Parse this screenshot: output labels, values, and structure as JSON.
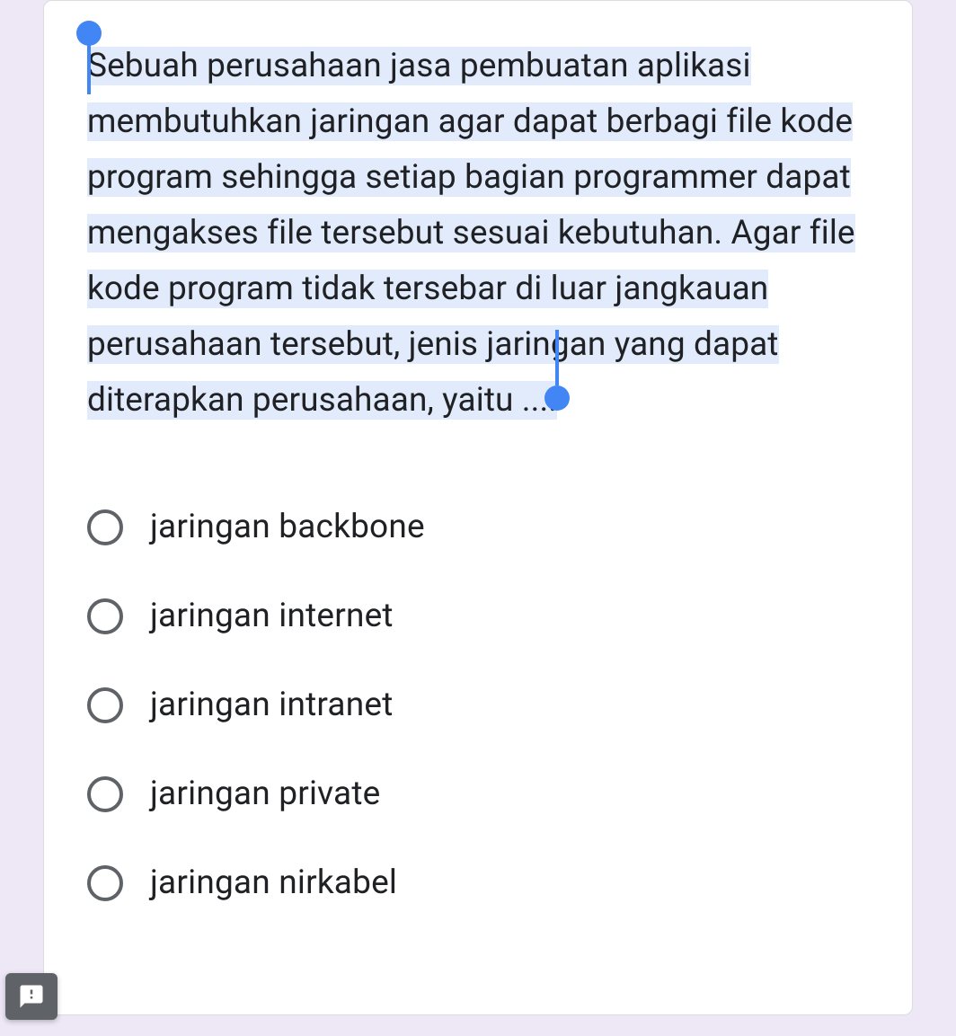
{
  "question": {
    "text": "Sebuah perusahaan jasa pembuatan aplikasi membutuhkan jaringan agar dapat berbagi file kode program sehingga setiap bagian programmer dapat mengakses file tersebut sesuai kebutuhan. Agar file kode program tidak tersebar di luar jangkauan perusahaan tersebut, jenis jaringan yang dapat diterapkan perusahaan, yaitu ...."
  },
  "options": [
    {
      "label": "jaringan backbone"
    },
    {
      "label": "jaringan internet"
    },
    {
      "label": "jaringan intranet"
    },
    {
      "label": "jaringan private"
    },
    {
      "label": "jaringan nirkabel"
    }
  ]
}
